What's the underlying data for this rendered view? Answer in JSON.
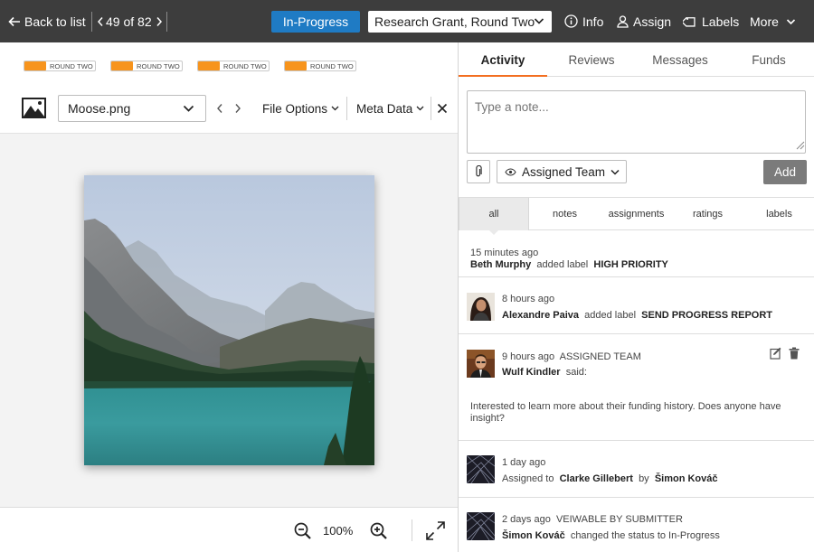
{
  "topbar": {
    "back_label": "Back to list",
    "position_label": "49 of 82",
    "status_label": "In-Progress",
    "round_value": "Research Grant, Round Two",
    "info_label": "Info",
    "assign_label": "Assign",
    "labels_label": "Labels",
    "more_label": "More"
  },
  "tags": [
    "ROUND TWO",
    "ROUND TWO",
    "ROUND TWO",
    "ROUND TWO"
  ],
  "tag_color": "#f7941d",
  "filebar": {
    "file_name": "Moose.png",
    "file_options_label": "File Options",
    "meta_data_label": "Meta Data"
  },
  "zoom": {
    "level": "100%"
  },
  "tabs": [
    "Activity",
    "Reviews",
    "Messages",
    "Funds"
  ],
  "active_tab_color": "#f36f21",
  "note": {
    "placeholder": "Type a note..."
  },
  "visibility": {
    "label": "Assigned Team"
  },
  "add_label": "Add",
  "filters": [
    "all",
    "notes",
    "assignments",
    "ratings",
    "labels"
  ],
  "activity": [
    {
      "time": "15 minutes ago",
      "user": "Beth Murphy",
      "action": "added label",
      "target": "HIGH PRIORITY"
    },
    {
      "time": "8 hours ago",
      "user": "Alexandre Paiva",
      "action": "added label",
      "target": "SEND PROGRESS REPORT"
    },
    {
      "time": "9 hours ago",
      "visibility": "ASSIGNED TEAM",
      "user": "Wulf Kindler",
      "action": "said:",
      "body": "Interested to learn more about their funding history. Does anyone have insight?"
    },
    {
      "time": "1 day ago",
      "prefix": "Assigned to",
      "user": "Clarke Gillebert",
      "by": "by",
      "actor": "Šimon Kováč"
    },
    {
      "time": "2 days ago",
      "visibility": "VEIWABLE BY SUBMITTER",
      "user": "Šimon Kováč",
      "action": "changed the status to In-Progress"
    }
  ]
}
